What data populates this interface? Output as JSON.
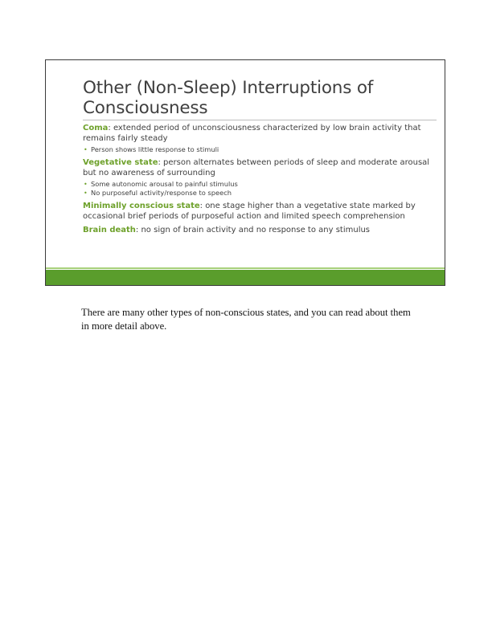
{
  "slide": {
    "title": "Other (Non-Sleep) Interruptions of Consciousness",
    "accent_color": "#6ea12b",
    "bar_color": "#5a9d2c",
    "items": [
      {
        "term": "Coma",
        "definition": ": extended period of unconsciousness characterized by low brain activity that remains fairly steady",
        "subpoints": [
          "Person shows little response to stimuli"
        ]
      },
      {
        "term": "Vegetative state",
        "definition": ": person alternates between periods of sleep and moderate arousal but no awareness of surrounding",
        "subpoints": [
          "Some autonomic arousal to painful stimulus",
          "No purposeful activity/response to speech"
        ]
      },
      {
        "term": "Minimally conscious state",
        "definition": ": one stage higher than a vegetative state marked by occasional brief periods of purposeful action and limited speech comprehension",
        "subpoints": []
      },
      {
        "term": "Brain death",
        "definition": ": no sign of brain activity and no response to any stimulus",
        "subpoints": []
      }
    ]
  },
  "caption": "There are many other types of non-conscious states, and you can read about them in more detail above."
}
